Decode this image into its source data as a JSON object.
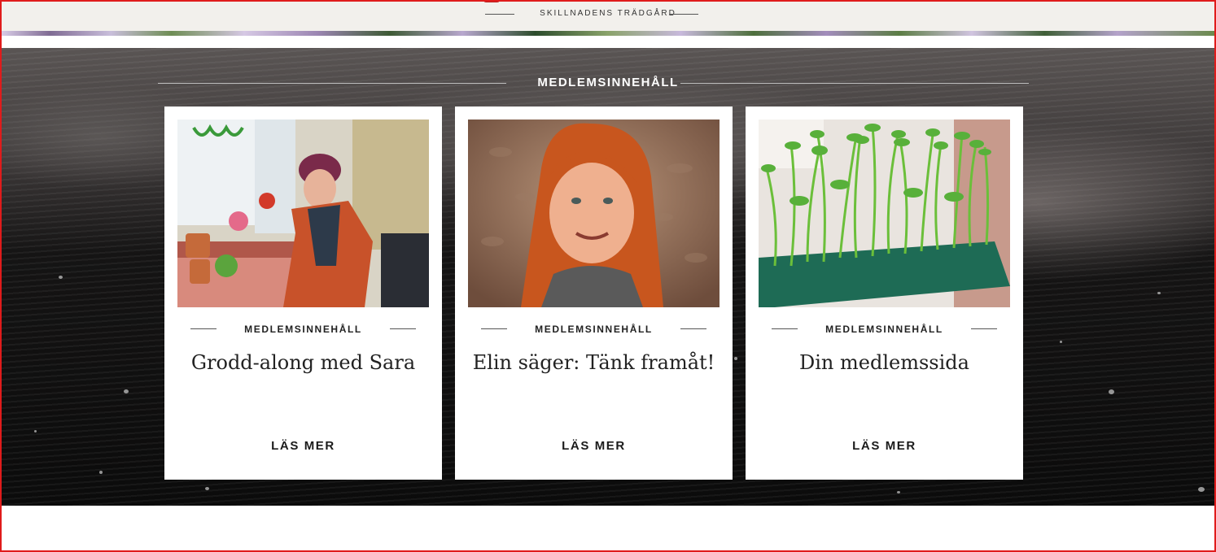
{
  "header": {
    "tagline": "SKILLNADENS TRÄDGÅRD"
  },
  "section": {
    "title": "MEDLEMSINNEHÅLL"
  },
  "cards": [
    {
      "image": "woman-with-sprouts-photo",
      "category": "MEDLEMSINNEHÅLL",
      "title": "Grodd-along med Sara",
      "button": "LÄS MER"
    },
    {
      "image": "red-haired-woman-portrait",
      "category": "MEDLEMSINNEHÅLL",
      "title": "Elin säger: Tänk framåt!",
      "button": "LÄS MER"
    },
    {
      "image": "pea-shoots-tray-photo",
      "category": "MEDLEMSINNEHÅLL",
      "title": "Din medlemssida",
      "button": "LÄS MER"
    }
  ],
  "colors": {
    "accent_border": "#e01b1b",
    "card_bg": "#ffffff",
    "soil_dark": "#0b0b0b"
  }
}
